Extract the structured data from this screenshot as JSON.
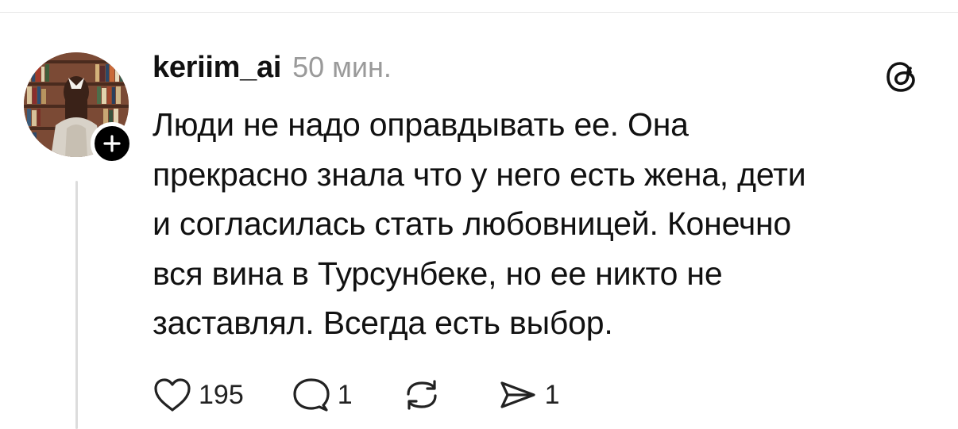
{
  "post": {
    "username": "keriim_ai",
    "timestamp": "50 мин.",
    "text": "Люди не надо оправдывать ее. Она\nпрекрасно знала что у него есть жена, дети\nи согласилась стать любовницей. Конечно\nвся вина в Турсунбеке, но ее никто не\nзаставлял. Всегда есть выбор.",
    "avatar_icon": "user-avatar-photo",
    "follow_icon": "plus-icon",
    "app_icon": "threads-logo-icon"
  },
  "actions": {
    "like": {
      "icon": "heart-icon",
      "count": "195"
    },
    "reply": {
      "icon": "comment-bubble-icon",
      "count": "1"
    },
    "repost": {
      "icon": "repost-icon",
      "count": ""
    },
    "share": {
      "icon": "send-icon",
      "count": "1"
    }
  },
  "colors": {
    "text": "#111111",
    "muted": "#9a9a9a",
    "thread_line": "#dcdcdc",
    "badge": "#000000"
  }
}
